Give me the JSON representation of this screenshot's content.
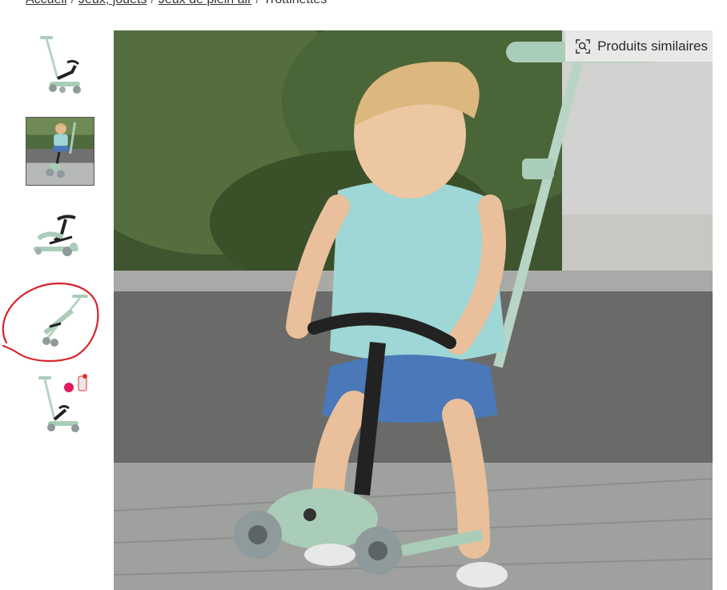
{
  "breadcrumb": {
    "items": [
      "Accueil",
      "Jeux, jouets",
      "Jeux de plein air",
      "Trottinettes"
    ],
    "separator": "/"
  },
  "gallery": {
    "thumbnails": [
      {
        "icon": "scooter-standing-thumb",
        "selected": false
      },
      {
        "icon": "child-on-scooter-thumb",
        "selected": true
      },
      {
        "icon": "scooter-seat-mode-thumb",
        "selected": false
      },
      {
        "icon": "scooter-folded-thumb",
        "selected": false
      },
      {
        "icon": "scooter-accessories-thumb",
        "selected": false
      }
    ],
    "annotation": "red-circle-around-thumbnail-4"
  },
  "main_image": {
    "icon": "child-riding-green-scooter-photo"
  },
  "similar_products": {
    "label": "Produits similaires",
    "icon": "visual-search-icon"
  },
  "colors": {
    "scooter_mint": "#a9cdb8",
    "annotation_red": "#d6232a",
    "button_bg": "#e8e8e6"
  }
}
